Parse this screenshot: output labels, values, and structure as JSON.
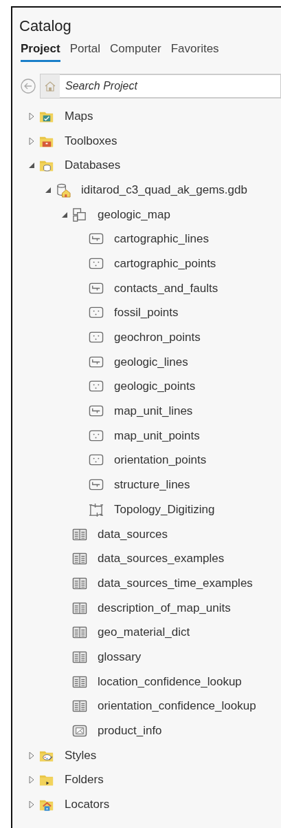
{
  "title": "Catalog",
  "tabs": [
    {
      "label": "Project",
      "selected": true
    },
    {
      "label": "Portal",
      "selected": false
    },
    {
      "label": "Computer",
      "selected": false
    },
    {
      "label": "Favorites",
      "selected": false
    }
  ],
  "search": {
    "placeholder": "Search Project"
  },
  "tree": [
    {
      "label": "Maps",
      "kind": "map-folder",
      "expanded": false
    },
    {
      "label": "Toolboxes",
      "kind": "toolbox-folder",
      "expanded": false
    },
    {
      "label": "Databases",
      "kind": "database-folder",
      "expanded": true,
      "children": [
        {
          "label": "iditarod_c3_quad_ak_gems.gdb",
          "kind": "gdb",
          "expanded": true,
          "children": [
            {
              "label": "geologic_map",
              "kind": "dataset",
              "expanded": true,
              "children": [
                {
                  "label": "cartographic_lines",
                  "kind": "line"
                },
                {
                  "label": "cartographic_points",
                  "kind": "point"
                },
                {
                  "label": "contacts_and_faults",
                  "kind": "line"
                },
                {
                  "label": "fossil_points",
                  "kind": "point"
                },
                {
                  "label": "geochron_points",
                  "kind": "point"
                },
                {
                  "label": "geologic_lines",
                  "kind": "line"
                },
                {
                  "label": "geologic_points",
                  "kind": "point"
                },
                {
                  "label": "map_unit_lines",
                  "kind": "line"
                },
                {
                  "label": "map_unit_points",
                  "kind": "point"
                },
                {
                  "label": "orientation_points",
                  "kind": "point"
                },
                {
                  "label": "structure_lines",
                  "kind": "line"
                },
                {
                  "label": "Topology_Digitizing",
                  "kind": "topology"
                }
              ]
            },
            {
              "label": "data_sources",
              "kind": "table"
            },
            {
              "label": "data_sources_examples",
              "kind": "table"
            },
            {
              "label": "data_sources_time_examples",
              "kind": "table"
            },
            {
              "label": "description_of_map_units",
              "kind": "table"
            },
            {
              "label": "geo_material_dict",
              "kind": "table"
            },
            {
              "label": "glossary",
              "kind": "table"
            },
            {
              "label": "location_confidence_lookup",
              "kind": "table"
            },
            {
              "label": "orientation_confidence_lookup",
              "kind": "table"
            },
            {
              "label": "product_info",
              "kind": "info-table"
            }
          ]
        }
      ]
    },
    {
      "label": "Styles",
      "kind": "style-folder",
      "expanded": false
    },
    {
      "label": "Folders",
      "kind": "folder",
      "expanded": false
    },
    {
      "label": "Locators",
      "kind": "locator-folder",
      "expanded": false
    }
  ]
}
